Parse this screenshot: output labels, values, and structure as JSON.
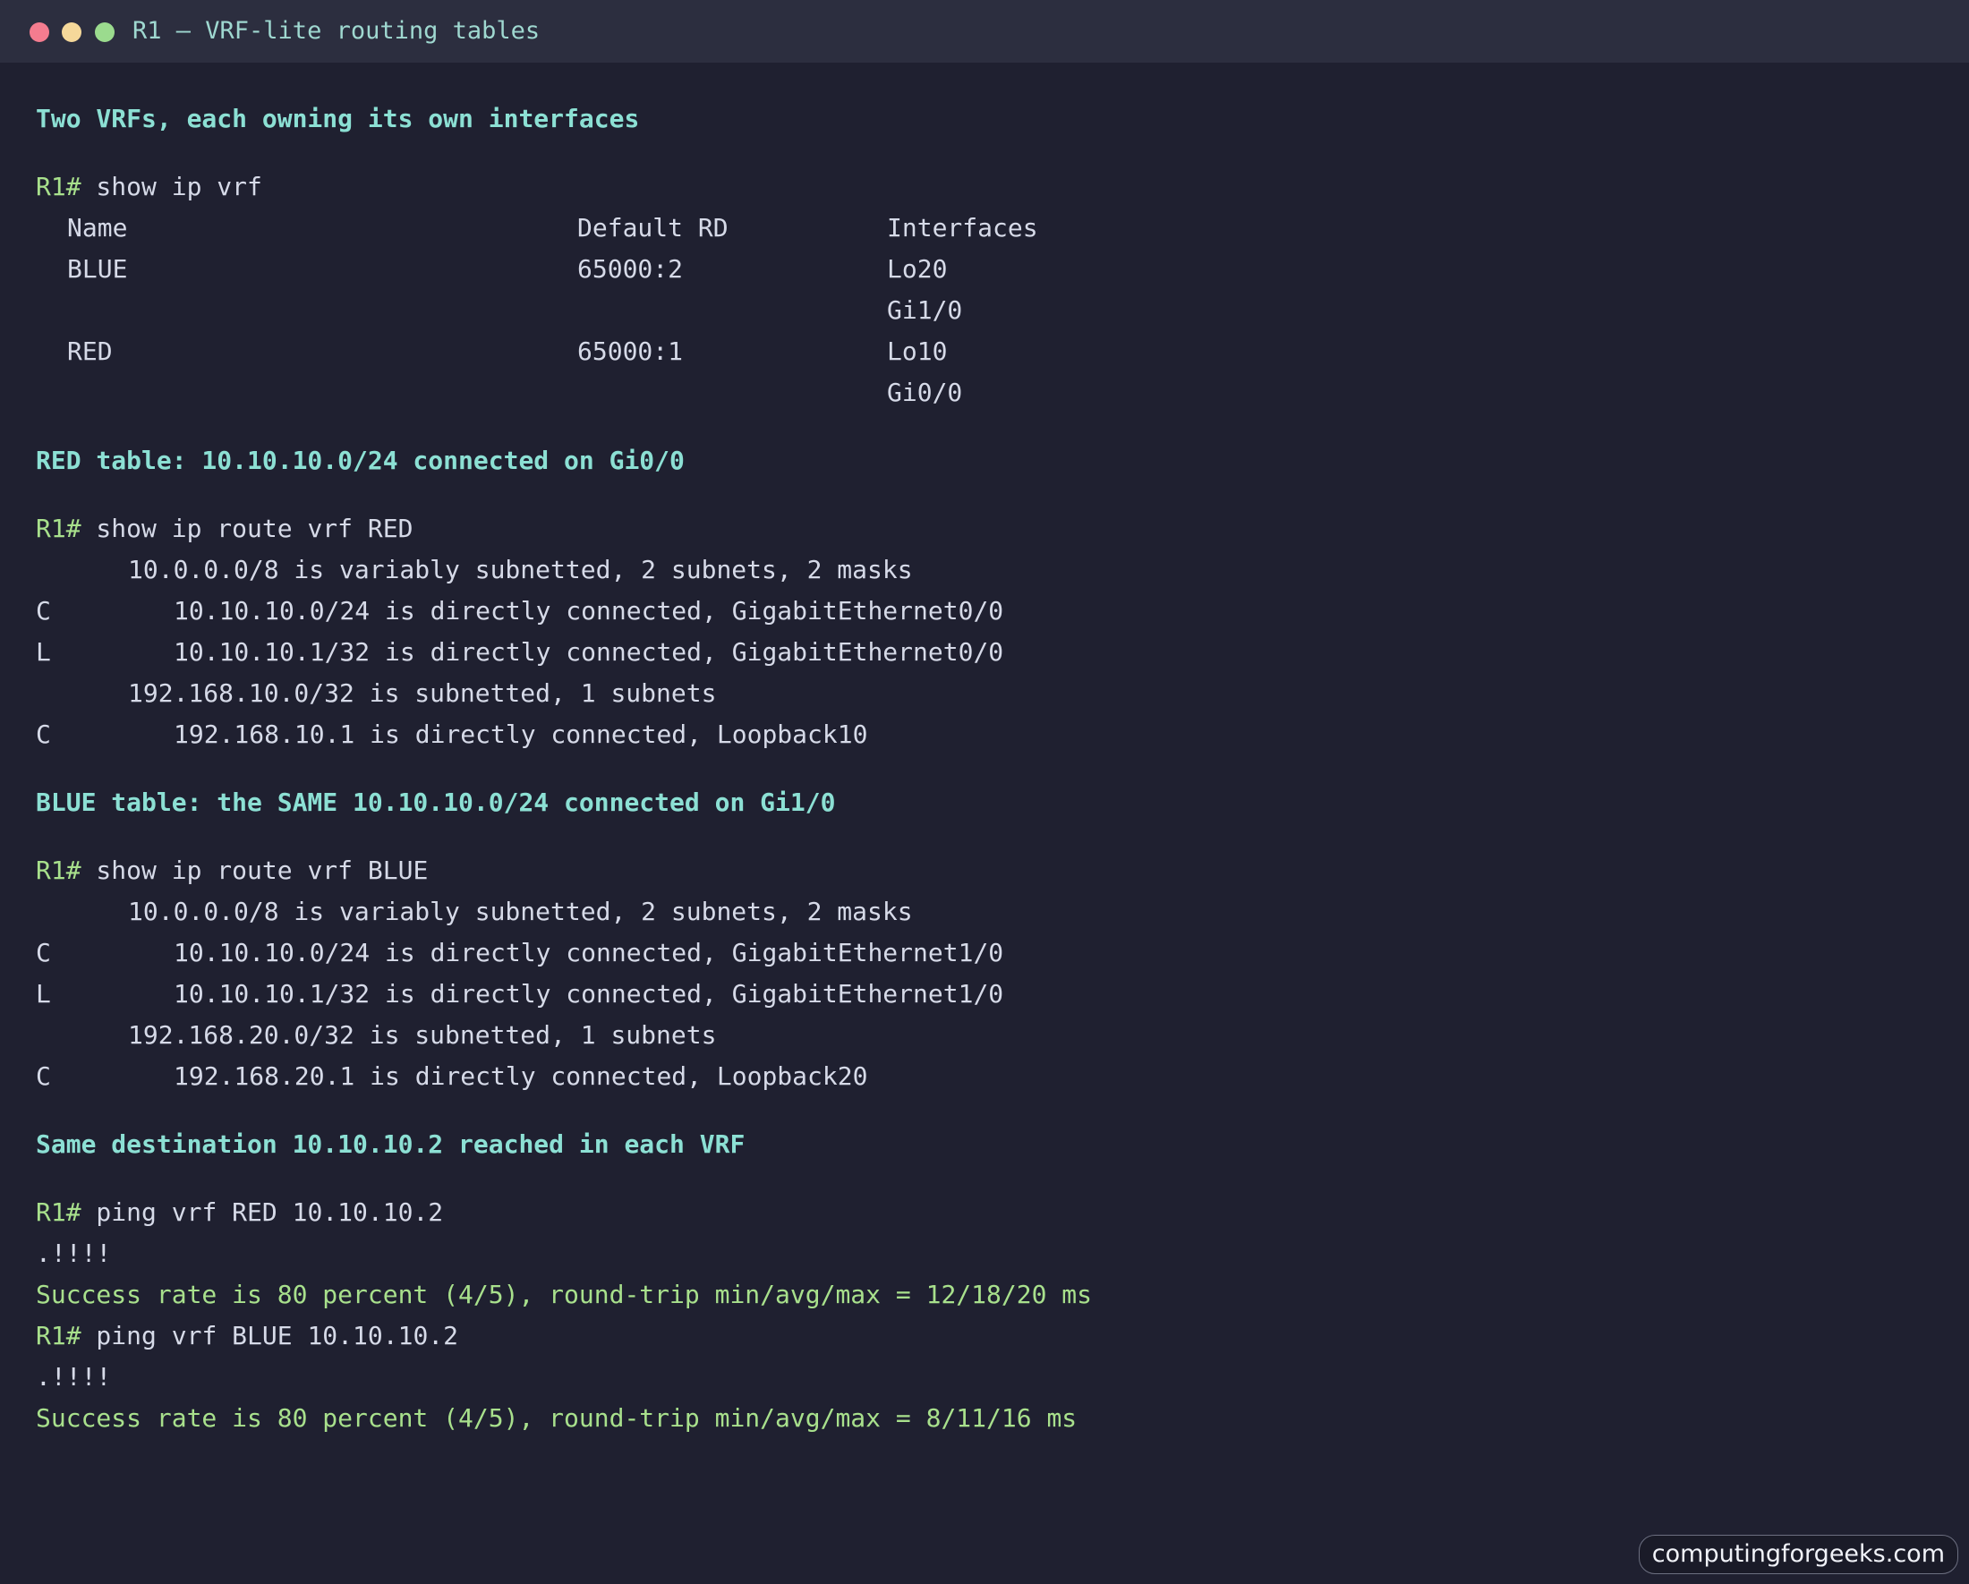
{
  "window": {
    "title": "R1 — VRF-lite routing tables"
  },
  "section1": {
    "heading": "Two VRFs, each owning its own interfaces",
    "prompt": "R1#",
    "command": " show ip vrf",
    "columns": {
      "name": "Name",
      "rd": "Default RD",
      "interfaces": "Interfaces"
    },
    "rows": [
      {
        "name": "BLUE",
        "rd": "65000:2",
        "interfaces": [
          "Lo20",
          "Gi1/0"
        ]
      },
      {
        "name": "RED",
        "rd": "65000:1",
        "interfaces": [
          "Lo10",
          "Gi0/0"
        ]
      }
    ]
  },
  "section2": {
    "heading": "RED table: 10.10.10.0/24 connected on Gi0/0",
    "prompt": "R1#",
    "command": " show ip route vrf RED",
    "routes": [
      {
        "code": "",
        "text": "10.0.0.0/8 is variably subnetted, 2 subnets, 2 masks"
      },
      {
        "code": "C",
        "text": "10.10.10.0/24 is directly connected, GigabitEthernet0/0"
      },
      {
        "code": "L",
        "text": "10.10.10.1/32 is directly connected, GigabitEthernet0/0"
      },
      {
        "code": "",
        "text": "192.168.10.0/32 is subnetted, 1 subnets"
      },
      {
        "code": "C",
        "text": "192.168.10.1 is directly connected, Loopback10"
      }
    ]
  },
  "section3": {
    "heading": "BLUE table: the SAME 10.10.10.0/24 connected on Gi1/0",
    "prompt": "R1#",
    "command": " show ip route vrf BLUE",
    "routes": [
      {
        "code": "",
        "text": "10.0.0.0/8 is variably subnetted, 2 subnets, 2 masks"
      },
      {
        "code": "C",
        "text": "10.10.10.0/24 is directly connected, GigabitEthernet1/0"
      },
      {
        "code": "L",
        "text": "10.10.10.1/32 is directly connected, GigabitEthernet1/0"
      },
      {
        "code": "",
        "text": "192.168.20.0/32 is subnetted, 1 subnets"
      },
      {
        "code": "C",
        "text": "192.168.20.1 is directly connected, Loopback20"
      }
    ]
  },
  "section4": {
    "heading": "Same destination 10.10.10.2 reached in each VRF",
    "pings": [
      {
        "prompt": "R1#",
        "command": " ping vrf RED 10.10.10.2",
        "marks": ".!!!!",
        "result": "Success rate is 80 percent (4/5), round-trip min/avg/max = 12/18/20 ms"
      },
      {
        "prompt": "R1#",
        "command": " ping vrf BLUE 10.10.10.2",
        "marks": ".!!!!",
        "result": "Success rate is 80 percent (4/5), round-trip min/avg/max = 8/11/16 ms"
      }
    ]
  },
  "watermark": "computingforgeeks.com",
  "colors": {
    "background": "#1f2030",
    "titlebar": "#2c2e3f",
    "heading": "#8ce0d4",
    "prompt": "#a8e08c",
    "text": "#d6dae8",
    "close": "#f47c8f",
    "minimize": "#f5d89a",
    "maximize": "#9bdb8e"
  }
}
